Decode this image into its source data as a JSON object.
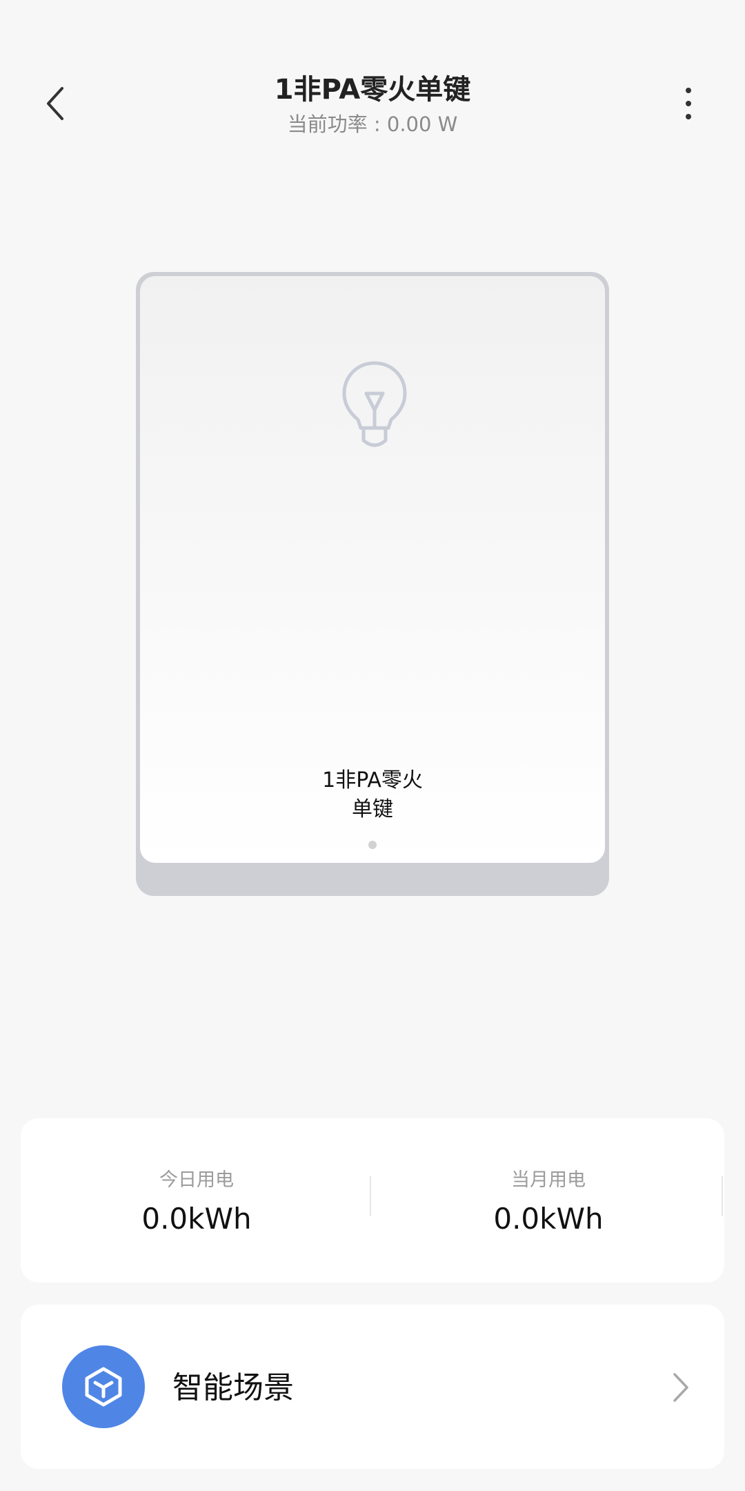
{
  "header": {
    "title": "1非PA零火单键",
    "subtitle": "当前功率 : 0.00 W"
  },
  "switch": {
    "label_line1": "1非PA零火",
    "label_line2": "单键",
    "icon": "lightbulb-icon"
  },
  "energy": {
    "today_label": "今日用电",
    "today_value": "0.0kWh",
    "month_label": "当月用电",
    "month_value": "0.0kWh"
  },
  "scene": {
    "label": "智能场景",
    "icon": "cube-icon"
  },
  "colors": {
    "background": "#f7f7f7",
    "accent": "#4f86e6",
    "switch_frame": "#cdcfd4",
    "bulb_outline": "#c8ccd6"
  }
}
